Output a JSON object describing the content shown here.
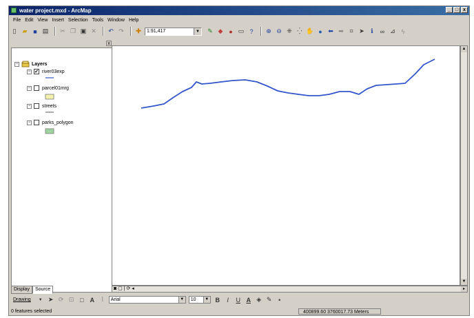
{
  "window": {
    "title": "water project.mxd - ArcMap",
    "controls": [
      "_",
      "□",
      "x"
    ]
  },
  "menu": [
    "File",
    "Edit",
    "View",
    "Insert",
    "Selection",
    "Tools",
    "Window",
    "Help"
  ],
  "toolbar": {
    "scale": "1:91,417"
  },
  "toc": {
    "root_label": "Layers",
    "layers": [
      {
        "name": "river03exp",
        "checked": true,
        "symbol": "line",
        "color": "#3355cc"
      },
      {
        "name": "parcel01mrg",
        "checked": false,
        "symbol": "polygon",
        "color": "#f4f0b0"
      },
      {
        "name": "streets",
        "checked": false,
        "symbol": "line",
        "color": "#555555"
      },
      {
        "name": "parks_polygon",
        "checked": false,
        "symbol": "polygon",
        "color": "#9fd39f"
      }
    ],
    "tabs": [
      "Display",
      "Source"
    ]
  },
  "drawing": {
    "label": "Drawing",
    "font": "Arial",
    "font_size": "10",
    "bold": "B",
    "italic": "I",
    "underline": "U"
  },
  "status": {
    "features": "0 features selected",
    "coords": "400899.60  3760017.73 Meters"
  },
  "colors": {
    "river": "#3355cc",
    "title_bar": "#0a246a"
  }
}
